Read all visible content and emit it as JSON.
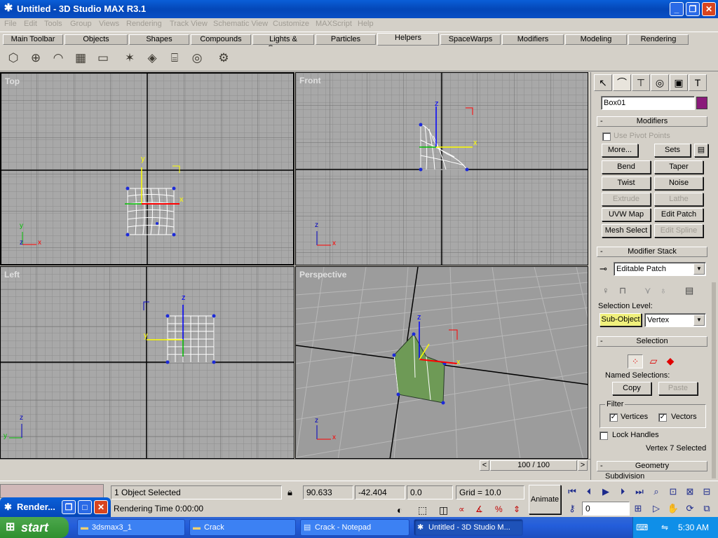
{
  "window": {
    "title": "Untitled - 3D Studio MAX R3.1",
    "minimize": "_",
    "restore": "❐",
    "close": "✕"
  },
  "menu": [
    "File",
    "Edit",
    "Tools",
    "Group",
    "Views",
    "Rendering",
    "Track View",
    "Schematic View",
    "Customize",
    "MAXScript",
    "Help"
  ],
  "tabs": [
    "Main Toolbar",
    "Objects",
    "Shapes",
    "Compounds",
    "Lights & Cameras",
    "Particles",
    "Helpers",
    "SpaceWarps",
    "Modifiers",
    "Modeling",
    "Rendering"
  ],
  "active_tab": "Helpers",
  "toolbar_icons": [
    "dummy-icon",
    "point-icon",
    "protractor-icon",
    "grid-icon",
    "tape-icon",
    "compass-icon",
    "box-gizmo-icon",
    "cylinder-gizmo-icon",
    "sphere-gizmo-icon",
    "camera-match-icon"
  ],
  "viewports": {
    "top": "Top",
    "front": "Front",
    "left": "Left",
    "perspective": "Perspective"
  },
  "axes": {
    "x": "x",
    "y": "y",
    "z": "z"
  },
  "command_panel": {
    "object_name": "Box01",
    "object_color": "#8a1a7a",
    "modifiers_title": "Modifiers",
    "use_pivot": "Use Pivot Points",
    "more": "More...",
    "sets": "Sets",
    "buttons": [
      "Bend",
      "Taper",
      "Twist",
      "Noise",
      "Extrude",
      "Lathe",
      "UVW Map",
      "Edit Patch",
      "Mesh Select",
      "Edit Spline"
    ],
    "disabled_buttons": [
      "Extrude",
      "Lathe",
      "Edit Spline"
    ],
    "modifier_stack_title": "Modifier Stack",
    "stack_value": "Editable Patch",
    "selection_level_label": "Selection Level:",
    "subobject": "Sub-Object",
    "level_value": "Vertex",
    "selection_title": "Selection",
    "named_selections": "Named Selections:",
    "copy": "Copy",
    "paste": "Paste",
    "filter": "Filter",
    "vertices": "Vertices",
    "vectors": "Vectors",
    "lock_handles": "Lock Handles",
    "vertex_selected": "Vertex 7 Selected",
    "geometry_title": "Geometry",
    "subdivision": "Subdivision"
  },
  "time_slider": {
    "frame": "100 / 100",
    "prev": "<",
    "next": ">"
  },
  "status": {
    "objects_selected": "1 Object Selected",
    "rendering_time": "Rendering Time  0:00:00",
    "x": "90.633",
    "y": "-42.404",
    "z": "0.0",
    "grid": "Grid = 10.0",
    "animate": "Animate",
    "frame": "0"
  },
  "float_window": {
    "title": "Render..."
  },
  "taskbar": {
    "start": "start",
    "tasks": [
      "3dsmax3_1",
      "Crack",
      "Crack - Notepad",
      "Untitled - 3D Studio M..."
    ],
    "clock": "5:30 AM"
  }
}
